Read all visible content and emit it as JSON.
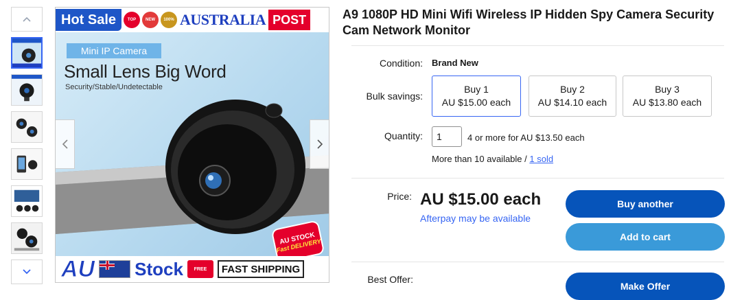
{
  "thumbnails": {
    "count": 6,
    "up_icon": "chevron-up-icon",
    "down_icon": "chevron-down-icon"
  },
  "main_image": {
    "top_banner": {
      "hot_sale": "Hot Sale",
      "badge_1": "TOP",
      "badge_2": "NEW",
      "badge_3": "100%",
      "australia": "AUSTRALIA",
      "post": "POST"
    },
    "mini_label": "Mini IP Camera",
    "headline": "Small Lens Big Word",
    "subline": "Security/Stable/Undetectable",
    "stock_badge_line1": "AU STOCK",
    "stock_badge_line2": "Fast DELIVERY",
    "bottom_banner": {
      "au": "AU",
      "stock": "Stock",
      "free": "FREE",
      "fast_shipping": "FAST SHIPPING"
    },
    "prev_icon": "chevron-left-icon",
    "next_icon": "chevron-right-icon"
  },
  "listing": {
    "title": "A9 1080P HD Mini Wifi Wireless IP Hidden Spy Camera Security Cam Network Monitor",
    "condition_label": "Condition:",
    "condition_value": "Brand New",
    "bulk_label": "Bulk savings:",
    "bulk_options": [
      {
        "qty": "Buy 1",
        "price": "AU $15.00 each"
      },
      {
        "qty": "Buy 2",
        "price": "AU $14.10 each"
      },
      {
        "qty": "Buy 3",
        "price": "AU $13.80 each"
      }
    ],
    "quantity_label": "Quantity:",
    "quantity_value": "1",
    "quantity_offer": "4 or more for AU $13.50 each",
    "availability": "More than 10 available / ",
    "sold_link": "1 sold",
    "price_label": "Price:",
    "price_value": "AU $15.00 each",
    "afterpay": "Afterpay may be available",
    "best_offer_label": "Best Offer:"
  },
  "buttons": {
    "buy_another": "Buy another",
    "add_to_cart": "Add to cart",
    "make_offer": "Make Offer"
  },
  "colors": {
    "primary_button": "#0654ba",
    "secondary_button": "#3a9ad9",
    "link": "#3665f3"
  }
}
